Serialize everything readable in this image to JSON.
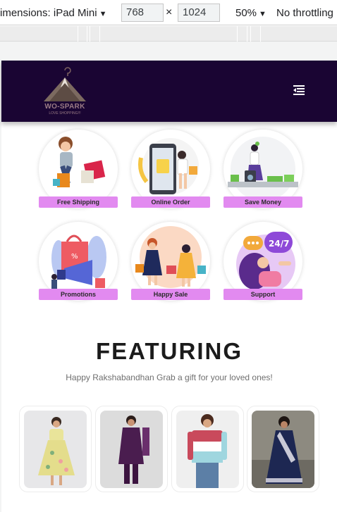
{
  "devtools": {
    "dimensions_label": "imensions: iPad Mini",
    "width_value": "768",
    "times_symbol": "×",
    "height_value": "1024",
    "zoom": "50%",
    "throttling": "No throttling"
  },
  "navbar": {
    "logo_title": "WO-SPARK",
    "logo_subtitle": "LOVE SHOPPING!!!",
    "menu_icon": "menu-icon"
  },
  "features": [
    {
      "label": "Free Shipping",
      "icon": "delivery-girl-illustration"
    },
    {
      "label": "Online Order",
      "icon": "online-order-illustration"
    },
    {
      "label": "Save Money",
      "icon": "save-money-illustration"
    },
    {
      "label": "Promotions",
      "icon": "megaphone-illustration"
    },
    {
      "label": "Happy Sale",
      "icon": "shopping-girls-illustration"
    },
    {
      "label": "Support",
      "icon": "support-chat-illustration"
    }
  ],
  "featuring": {
    "heading": "FEATURING",
    "subheading": "Happy Rakshabandhan Grab a gift for your loved ones!"
  },
  "products": [
    {
      "name": "yellow-floral-dress"
    },
    {
      "name": "purple-kurta-set"
    },
    {
      "name": "colorblock-sweater"
    },
    {
      "name": "navy-saree"
    }
  ],
  "colors": {
    "navbar_bg": "#1a0533",
    "label_bg": "#e28af0",
    "logo_text": "#9a7b85"
  }
}
